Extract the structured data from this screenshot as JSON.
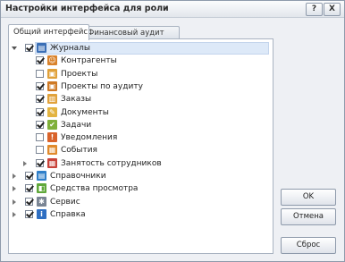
{
  "window": {
    "title": "Настройки интерфейса для роли",
    "help_label": "?",
    "close_label": "X"
  },
  "tabs": [
    {
      "label": "Общий интерфейс",
      "active": true
    },
    {
      "label": "Финансовый аудит",
      "active": false
    }
  ],
  "tree": [
    {
      "label": "Журналы",
      "checked": true,
      "expander": "open",
      "level": 0,
      "icon": "journal-icon",
      "selected": true
    },
    {
      "label": "Контрагенты",
      "checked": true,
      "expander": "none",
      "level": 1,
      "icon": "counterparty-icon"
    },
    {
      "label": "Проекты",
      "checked": false,
      "expander": "none",
      "level": 1,
      "icon": "projects-icon"
    },
    {
      "label": "Проекты по аудиту",
      "checked": true,
      "expander": "none",
      "level": 1,
      "icon": "audit-projects-icon"
    },
    {
      "label": "Заказы",
      "checked": true,
      "expander": "none",
      "level": 1,
      "icon": "orders-icon"
    },
    {
      "label": "Документы",
      "checked": true,
      "expander": "none",
      "level": 1,
      "icon": "documents-icon"
    },
    {
      "label": "Задачи",
      "checked": true,
      "expander": "none",
      "level": 1,
      "icon": "tasks-icon"
    },
    {
      "label": "Уведомления",
      "checked": false,
      "expander": "none",
      "level": 1,
      "icon": "notifications-icon"
    },
    {
      "label": "События",
      "checked": false,
      "expander": "none",
      "level": 1,
      "icon": "events-icon"
    },
    {
      "label": "Занятость сотрудников",
      "checked": true,
      "expander": "closed",
      "level": 1,
      "icon": "employee-schedule-icon"
    },
    {
      "label": "Справочники",
      "checked": true,
      "expander": "closed",
      "level": 0,
      "icon": "references-icon"
    },
    {
      "label": "Средства просмотра",
      "checked": true,
      "expander": "closed",
      "level": 0,
      "icon": "viewers-icon"
    },
    {
      "label": "Сервис",
      "checked": true,
      "expander": "closed",
      "level": 0,
      "icon": "service-icon"
    },
    {
      "label": "Справка",
      "checked": true,
      "expander": "closed",
      "level": 0,
      "icon": "help-info-icon"
    }
  ],
  "buttons": {
    "ok": "OK",
    "cancel": "Отмена",
    "reset": "Сброс"
  }
}
